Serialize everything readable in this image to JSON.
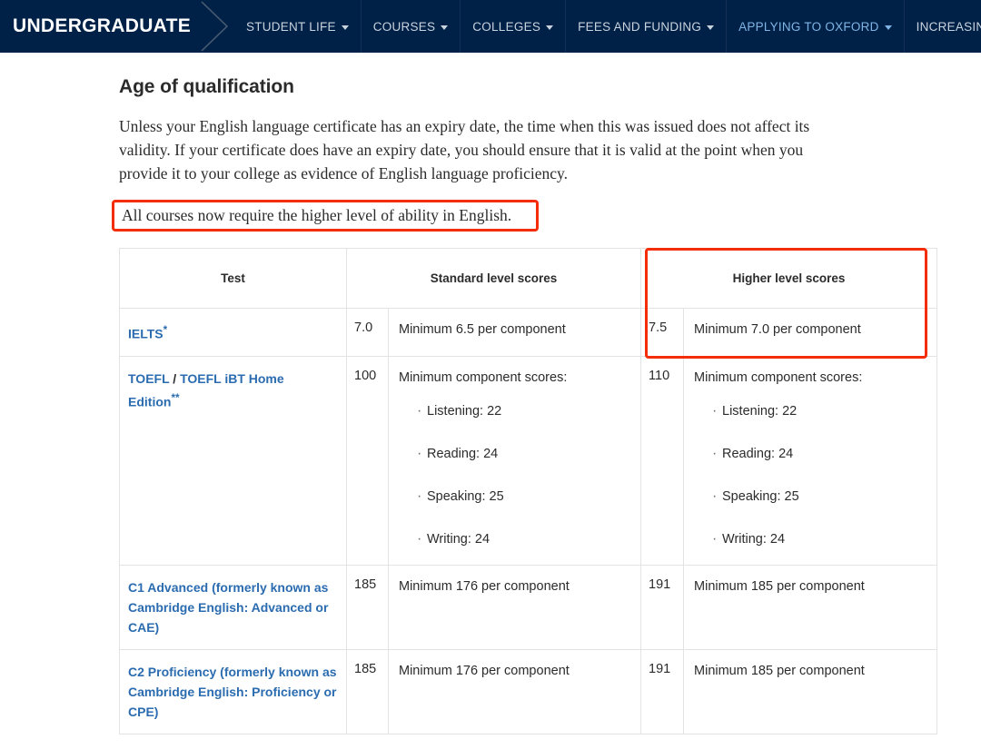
{
  "nav": {
    "brand": "UNDERGRADUATE",
    "items": [
      {
        "label": "STUDENT LIFE",
        "active": false
      },
      {
        "label": "COURSES",
        "active": false
      },
      {
        "label": "COLLEGES",
        "active": false
      },
      {
        "label": "FEES AND FUNDING",
        "active": false
      },
      {
        "label": "APPLYING TO OXFORD",
        "active": true
      },
      {
        "label": "INCREASING ACCESS",
        "active": false
      }
    ]
  },
  "main": {
    "title": "Age of qualification",
    "paragraph": "Unless your English language certificate has an expiry date, the time when this was issued does not affect its validity. If your certificate does have an expiry date, you should ensure that it is valid at the point when you provide it to your college as evidence of English language proficiency.",
    "callout": "All courses now require the higher level of ability in English."
  },
  "table": {
    "headers": {
      "test": "Test",
      "standard": "Standard level scores",
      "higher": "Higher level scores"
    },
    "rows": [
      {
        "test_primary": "IELTS",
        "test_sep": "",
        "test_secondary": "",
        "test_marker": "*",
        "standard_score": "7.0",
        "standard_detail": "Minimum 6.5 per component",
        "standard_bullets": [],
        "higher_score": "7.5",
        "higher_detail": "Minimum 7.0 per component",
        "higher_bullets": []
      },
      {
        "test_primary": "TOEFL",
        "test_sep": " / ",
        "test_secondary": "TOEFL iBT Home Edition",
        "test_marker": "**",
        "standard_score": "100",
        "standard_detail": "Minimum component scores:",
        "standard_bullets": [
          "Listening: 22",
          "Reading: 24",
          "Speaking: 25",
          "Writing: 24"
        ],
        "higher_score": "110",
        "higher_detail": "Minimum component scores:",
        "higher_bullets": [
          "Listening: 22",
          "Reading: 24",
          "Speaking: 25",
          "Writing: 24"
        ]
      },
      {
        "test_primary": "C1 Advanced (formerly known as Cambridge English: Advanced or CAE)",
        "test_sep": "",
        "test_secondary": "",
        "test_marker": "",
        "standard_score": "185",
        "standard_detail": "Minimum 176 per component",
        "standard_bullets": [],
        "higher_score": "191",
        "higher_detail": "Minimum 185 per component",
        "higher_bullets": []
      },
      {
        "test_primary": "C2 Proficiency (formerly known as Cambridge English: Proficiency or CPE)",
        "test_sep": "",
        "test_secondary": "",
        "test_marker": "",
        "standard_score": "185",
        "standard_detail": "Minimum 176 per component",
        "standard_bullets": [],
        "higher_score": "191",
        "higher_detail": "Minimum 185 per component",
        "higher_bullets": []
      }
    ]
  },
  "annotations": {
    "highlight_color": "#f42c07",
    "callout_boxed": true,
    "higher_column_boxed": true
  },
  "colors": {
    "nav_background": "#002147",
    "nav_active_text": "#7fb5e6",
    "link_blue": "#2b6cb0",
    "body_text": "#2b2b2b",
    "annotation_red": "#f42c07",
    "table_border": "#e3e3e3"
  }
}
